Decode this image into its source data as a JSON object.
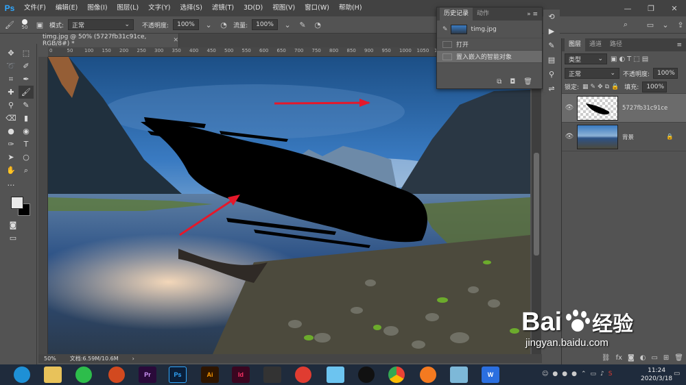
{
  "app": {
    "logo": "Ps",
    "menu": [
      "文件(F)",
      "编辑(E)",
      "图像(I)",
      "图层(L)",
      "文字(Y)",
      "选择(S)",
      "滤镜(T)",
      "3D(D)",
      "视图(V)",
      "窗口(W)",
      "帮助(H)"
    ]
  },
  "options": {
    "size": "50",
    "mode_label": "模式:",
    "mode_value": "正常",
    "opacity_label": "不透明度:",
    "opacity_value": "100%",
    "flow_label": "流量:",
    "flow_value": "100%"
  },
  "document": {
    "tab_title": "timg.jpg @ 50% (5727fb31c91ce, RGB/8#) *",
    "zoom": "50%",
    "doc_info": "文档:6.59M/10.6M",
    "ruler_marks": [
      "0",
      "50",
      "100",
      "150",
      "200",
      "250",
      "300",
      "350",
      "400",
      "450",
      "500",
      "550",
      "600",
      "650",
      "700",
      "750",
      "800",
      "850",
      "900",
      "950",
      "1000",
      "1050",
      "1100",
      "1150",
      "1200",
      "1250",
      "1300",
      "1350"
    ]
  },
  "history": {
    "tabs": [
      "历史记录",
      "动作"
    ],
    "source": "timg.jpg",
    "steps": [
      "打开",
      "置入嵌入的智能对象"
    ]
  },
  "layers": {
    "tabs": [
      "图层",
      "通道",
      "路径"
    ],
    "filter": "类型",
    "blend": "正常",
    "opacity_label": "不透明度:",
    "opacity": "100%",
    "lock_label": "锁定:",
    "fill_label": "填充:",
    "fill": "100%",
    "items": [
      {
        "name": "5727fb31c91ce"
      },
      {
        "name": "背景"
      }
    ]
  },
  "taskbar": {
    "apps": [
      "Pr",
      "Ps",
      "Ai",
      "Id"
    ],
    "time": "11:24",
    "date": "2020/3/18"
  },
  "watermark": {
    "brand": "Bai",
    "brand2": "经验",
    "url": "jingyan.baidu.com"
  }
}
